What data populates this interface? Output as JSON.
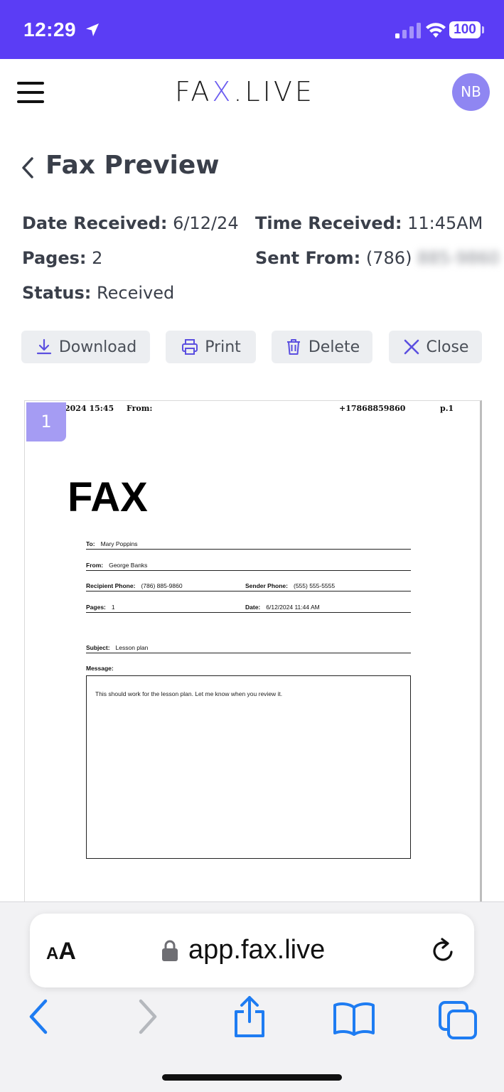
{
  "status_bar": {
    "time": "12:29",
    "battery": "100",
    "background_color": "#5b3df5"
  },
  "app": {
    "logo": {
      "part1": "FA",
      "part2": "X",
      "part3": ".LIVE"
    },
    "avatar_initials": "NB",
    "accent_color": "#6b5cf0"
  },
  "page": {
    "title": "Fax Preview"
  },
  "meta": {
    "date_label": "Date Received:",
    "date_value": "6/12/24",
    "time_label": "Time Received:",
    "time_value": "11:45AM",
    "pages_label": "Pages:",
    "pages_value": "2",
    "sent_label": "Sent From:",
    "sent_value_visible": "(786)",
    "sent_value_blurred": "885-9860",
    "status_label": "Status:",
    "status_value": "Received"
  },
  "actions": {
    "download": "Download",
    "print": "Print",
    "delete": "Delete",
    "close": "Close"
  },
  "preview": {
    "page_number": "1",
    "header": {
      "datetime": "2024  15:45",
      "from": "From:",
      "number": "+17868859860",
      "page": "p.1"
    },
    "big_title": "FAX",
    "to_label": "To:",
    "to_value": "Mary Poppins",
    "from_label": "From:",
    "from_value": "George Banks",
    "recipient_phone_label": "Recipient Phone:",
    "recipient_phone_value": "(786) 885-9860",
    "sender_phone_label": "Sender Phone:",
    "sender_phone_value": "(555) 555-5555",
    "pages_label": "Pages:",
    "pages_value": "1",
    "date_label": "Date:",
    "date_value": "6/12/2024 11:44 AM",
    "subject_label": "Subject:",
    "subject_value": "Lesson plan",
    "message_label": "Message:",
    "message_value": "This should work for the lesson plan. Let me know when you review it."
  },
  "browser": {
    "text_size_small": "A",
    "text_size_large": "A",
    "url": "app.fax.live",
    "icons": [
      "back-icon",
      "forward-icon",
      "share-icon",
      "bookmarks-icon",
      "tabs-icon"
    ],
    "tint_color": "#1e7cf2"
  }
}
